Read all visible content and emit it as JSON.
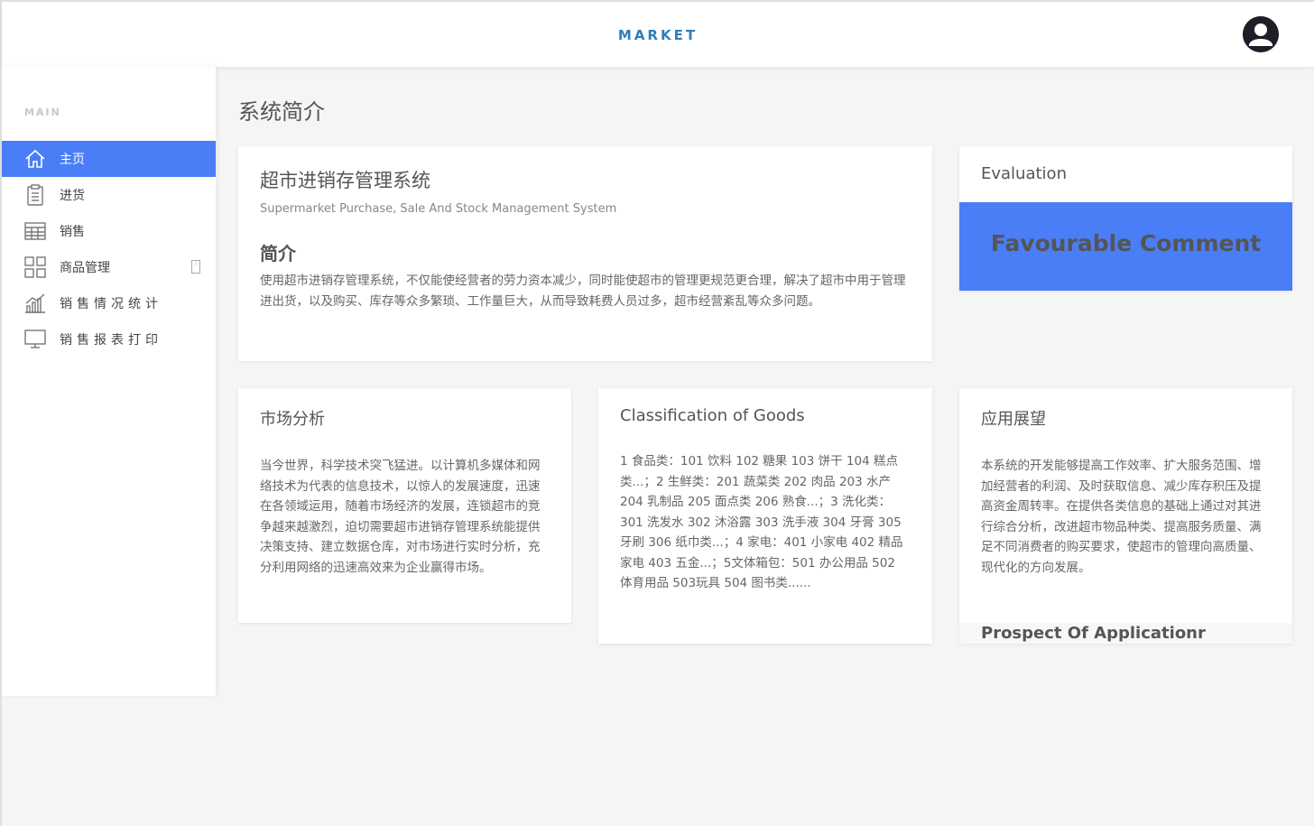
{
  "header": {
    "brand": "MARKET",
    "avatar_icon": "user-avatar-icon"
  },
  "sidebar": {
    "heading": "MAIN",
    "items": [
      {
        "label": "主页",
        "icon": "home-icon",
        "active": true
      },
      {
        "label": "进货",
        "icon": "clipboard-icon",
        "active": false
      },
      {
        "label": "销售",
        "icon": "calendar-table-icon",
        "active": false
      },
      {
        "label": "商品管理",
        "icon": "grid-icon",
        "active": false
      },
      {
        "label": "销售情况统计",
        "icon": "bar-chart-icon",
        "active": false
      },
      {
        "label": "销售报表打印",
        "icon": "monitor-icon",
        "active": false
      }
    ]
  },
  "main": {
    "page_title": "系统简介",
    "intro": {
      "title": "超市进销存管理系统",
      "subtitle": "Supermarket Purchase, Sale And Stock Management System",
      "heading": "简介",
      "text": "使用超市进销存管理系统，不仅能使经营者的劳力资本减少，同时能使超市的管理更规范更合理，解决了超市中用于管理进出货，以及购买、库存等众多繁琐、工作量巨大，从而导致耗费人员过多，超市经营紊乱等众多问题。"
    },
    "evaluation": {
      "title": "Evaluation",
      "band_text": "Favourable Comment"
    },
    "market": {
      "title": "市场分析",
      "text": "当今世界，科学技术突飞猛进。以计算机多媒体和网络技术为代表的信息技术，以惊人的发展速度，迅速在各领域运用，随着市场经济的发展，连锁超市的竞争越来越激烈，迫切需要超市进销存管理系统能提供决策支持、建立数据仓库，对市场进行实时分析，充分利用网络的迅速高效来为企业赢得市场。"
    },
    "goods": {
      "title": "Classification of Goods",
      "text": "1 食品类：101 饮料 102 糖果 103 饼干 104 糕点类...；2 生鲜类：201 蔬菜类 202 肉品 203 水产 204 乳制品 205 面点类 206 熟食...；3 洗化类：301 洗发水 302 沐浴露 303 洗手液 304 牙膏 305 牙刷 306 纸巾类...；4 家电：401 小家电 402 精品家电 403 五金...；5文体箱包：501 办公用品 502 体育用品 503玩具 504 图书类......"
    },
    "prospect": {
      "title": "应用展望",
      "text": "本系统的开发能够提高工作效率、扩大服务范围、增加经营者的利润、及时获取信息、减少库存积压及提高资金周转率。在提供各类信息的基础上通过对其进行综合分析，改进超市物品种类、提高服务质量、满足不同消费者的购买要求，使超市的管理向高质量、现代化的方向发展。",
      "footer": "Prospect Of Applicationr"
    }
  },
  "colors": {
    "accent": "#4a7ef6",
    "brand": "#2d7fb8",
    "background": "#f5f5f5"
  }
}
